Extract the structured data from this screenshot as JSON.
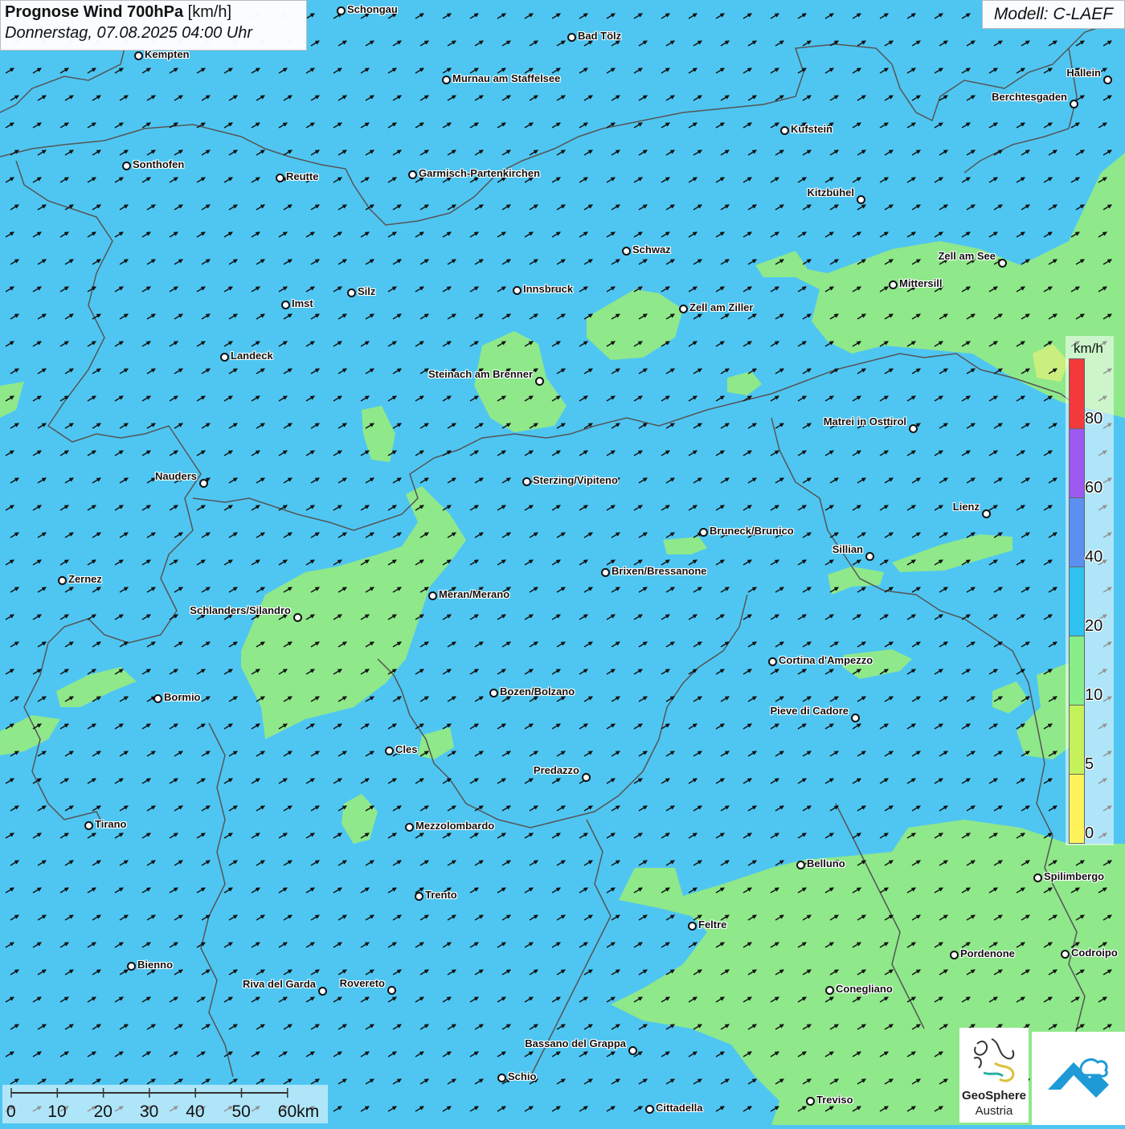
{
  "title": {
    "main": "Prognose Wind 700hPa",
    "unit": "[km/h]",
    "datetime": "Donnerstag, 07.08.2025 04:00 Uhr"
  },
  "model": "Modell: C-LAEF",
  "legend": {
    "unit": "km/h",
    "bands": [
      {
        "from": 0,
        "to": 5,
        "color": "#fff35c"
      },
      {
        "from": 5,
        "to": 10,
        "color": "#c5f25a"
      },
      {
        "from": 10,
        "to": 20,
        "color": "#88ee88"
      },
      {
        "from": 20,
        "to": 40,
        "color": "#2fc2ee"
      },
      {
        "from": 40,
        "to": 60,
        "color": "#5b8ff0"
      },
      {
        "from": 60,
        "to": 80,
        "color": "#9b59f0"
      },
      {
        "from": 80,
        "to": 100,
        "color": "#f23a3a"
      }
    ],
    "labels": [
      "0",
      "5",
      "10",
      "20",
      "40",
      "60",
      "80"
    ]
  },
  "scale": {
    "labels": [
      "0",
      "10",
      "20",
      "30",
      "40",
      "50",
      "60km"
    ]
  },
  "logo": {
    "line1": "GeoSphere",
    "line2": "Austria"
  },
  "colors": {
    "sea_blue": "#4fc6f2",
    "green_area": "#8fe88a",
    "yellow_area": "#d8f07a",
    "border": "#555555",
    "arrow": "#111111",
    "logo_teal": "#1e9bd7"
  },
  "cities": [
    {
      "name": "Schongau"
    },
    {
      "name": "Bad Tölz"
    },
    {
      "name": "Kempten"
    },
    {
      "name": "Murnau am Staffelsee"
    },
    {
      "name": "Hallein"
    },
    {
      "name": "Berchtesgaden"
    },
    {
      "name": "Kufstein"
    },
    {
      "name": "Sonthofen"
    },
    {
      "name": "Reutte"
    },
    {
      "name": "Garmisch-Partenkirchen"
    },
    {
      "name": "Kitzbühel"
    },
    {
      "name": "Schwaz"
    },
    {
      "name": "Zell am See"
    },
    {
      "name": "Mittersill"
    },
    {
      "name": "Innsbruck"
    },
    {
      "name": "Silz"
    },
    {
      "name": "Imst"
    },
    {
      "name": "Zell am Ziller"
    },
    {
      "name": "Landeck"
    },
    {
      "name": "Steinach am Brenner"
    },
    {
      "name": "Matrei in Osttirol"
    },
    {
      "name": "Nauders"
    },
    {
      "name": "Sterzing/Vipiteno"
    },
    {
      "name": "Lienz"
    },
    {
      "name": "Bruneck/Brunico"
    },
    {
      "name": "Sillian"
    },
    {
      "name": "Zernez"
    },
    {
      "name": "Brixen/Bressanone"
    },
    {
      "name": "Meran/Merano"
    },
    {
      "name": "Schlanders/Silandro"
    },
    {
      "name": "Cortina d'Ampezzo"
    },
    {
      "name": "Bozen/Bolzano"
    },
    {
      "name": "Bormio"
    },
    {
      "name": "Pieve di Cadore"
    },
    {
      "name": "Cles"
    },
    {
      "name": "Predazzo"
    },
    {
      "name": "Tirano"
    },
    {
      "name": "Mezzolombardo"
    },
    {
      "name": "Belluno"
    },
    {
      "name": "Spilimbergo"
    },
    {
      "name": "Trento"
    },
    {
      "name": "Feltre"
    },
    {
      "name": "Pordenone"
    },
    {
      "name": "Codroipo"
    },
    {
      "name": "Bienno"
    },
    {
      "name": "Riva del Garda"
    },
    {
      "name": "Rovereto"
    },
    {
      "name": "Conegliano"
    },
    {
      "name": "Bassano del Grappa"
    },
    {
      "name": "Schio"
    },
    {
      "name": "Treviso"
    },
    {
      "name": "Cittadella"
    }
  ]
}
